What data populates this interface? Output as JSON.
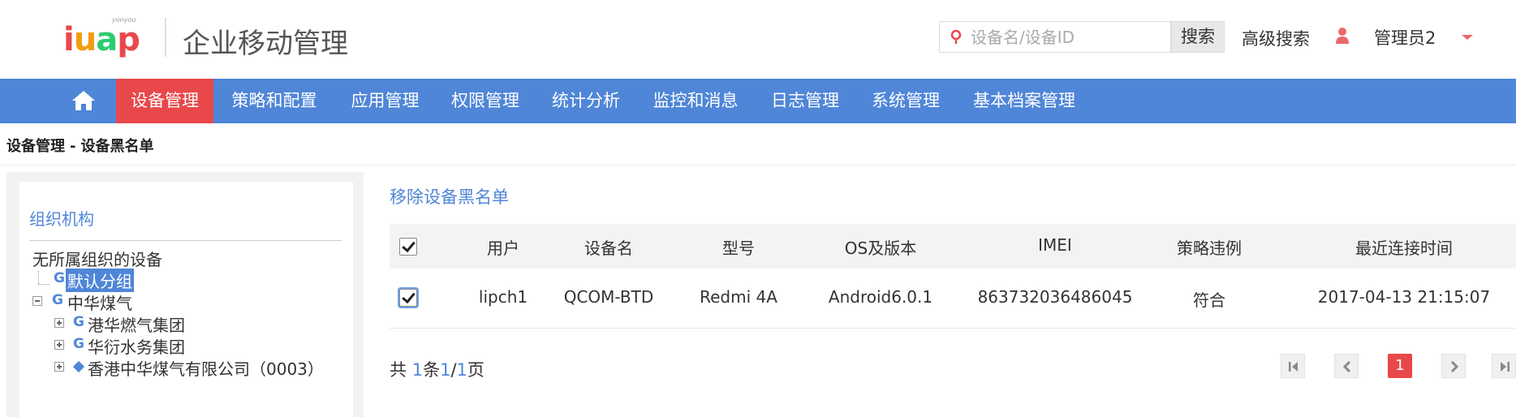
{
  "header": {
    "logo_small": "yonyou",
    "logo_text": "iuap",
    "app_title": "企业移动管理",
    "search_placeholder": "设备名/设备ID",
    "search_button": "搜索",
    "advanced_search": "高级搜索",
    "user_name": "管理员2"
  },
  "nav": {
    "home_icon": "home-icon",
    "items": [
      {
        "label": "设备管理",
        "active": true
      },
      {
        "label": "策略和配置"
      },
      {
        "label": "应用管理"
      },
      {
        "label": "权限管理"
      },
      {
        "label": "统计分析"
      },
      {
        "label": "监控和消息"
      },
      {
        "label": "日志管理"
      },
      {
        "label": "系统管理"
      },
      {
        "label": "基本档案管理"
      }
    ],
    "active_color": "#e9484a",
    "bar_color": "#4f86d8"
  },
  "breadcrumb": {
    "parent": "设备管理",
    "separator": "-",
    "current": "设备黑名单"
  },
  "sidebar": {
    "title": "组织机构",
    "tree": [
      {
        "label": "无所属组织的设备"
      },
      {
        "label": "默认分组",
        "icon": "G",
        "selected": true
      },
      {
        "label": "中华煤气",
        "icon": "G",
        "expanded": true
      },
      {
        "label": "港华燃气集团",
        "icon": "G"
      },
      {
        "label": "华衍水务集团",
        "icon": "G"
      },
      {
        "label": "香港中华煤气有限公司（0003）",
        "icon": "diamond-icon"
      }
    ]
  },
  "main": {
    "remove_link": "移除设备黑名单",
    "columns": [
      "用户",
      "设备名",
      "型号",
      "OS及版本",
      "IMEI",
      "策略违例",
      "最近连接时间"
    ],
    "rows": [
      {
        "checked": true,
        "user": "lipch1",
        "device": "QCOM-BTD",
        "model": "Redmi 4A",
        "os": "Android6.0.1",
        "imei": "863732036486045",
        "policy": "符合",
        "last_connect": "2017-04-13 21:15:07"
      }
    ]
  },
  "footer": {
    "total_prefix": "共",
    "total_count": "1",
    "total_unit": "条",
    "page_current": "1",
    "page_sep": "/",
    "page_total": "1",
    "page_suffix": "页",
    "current_page_button": "1"
  }
}
